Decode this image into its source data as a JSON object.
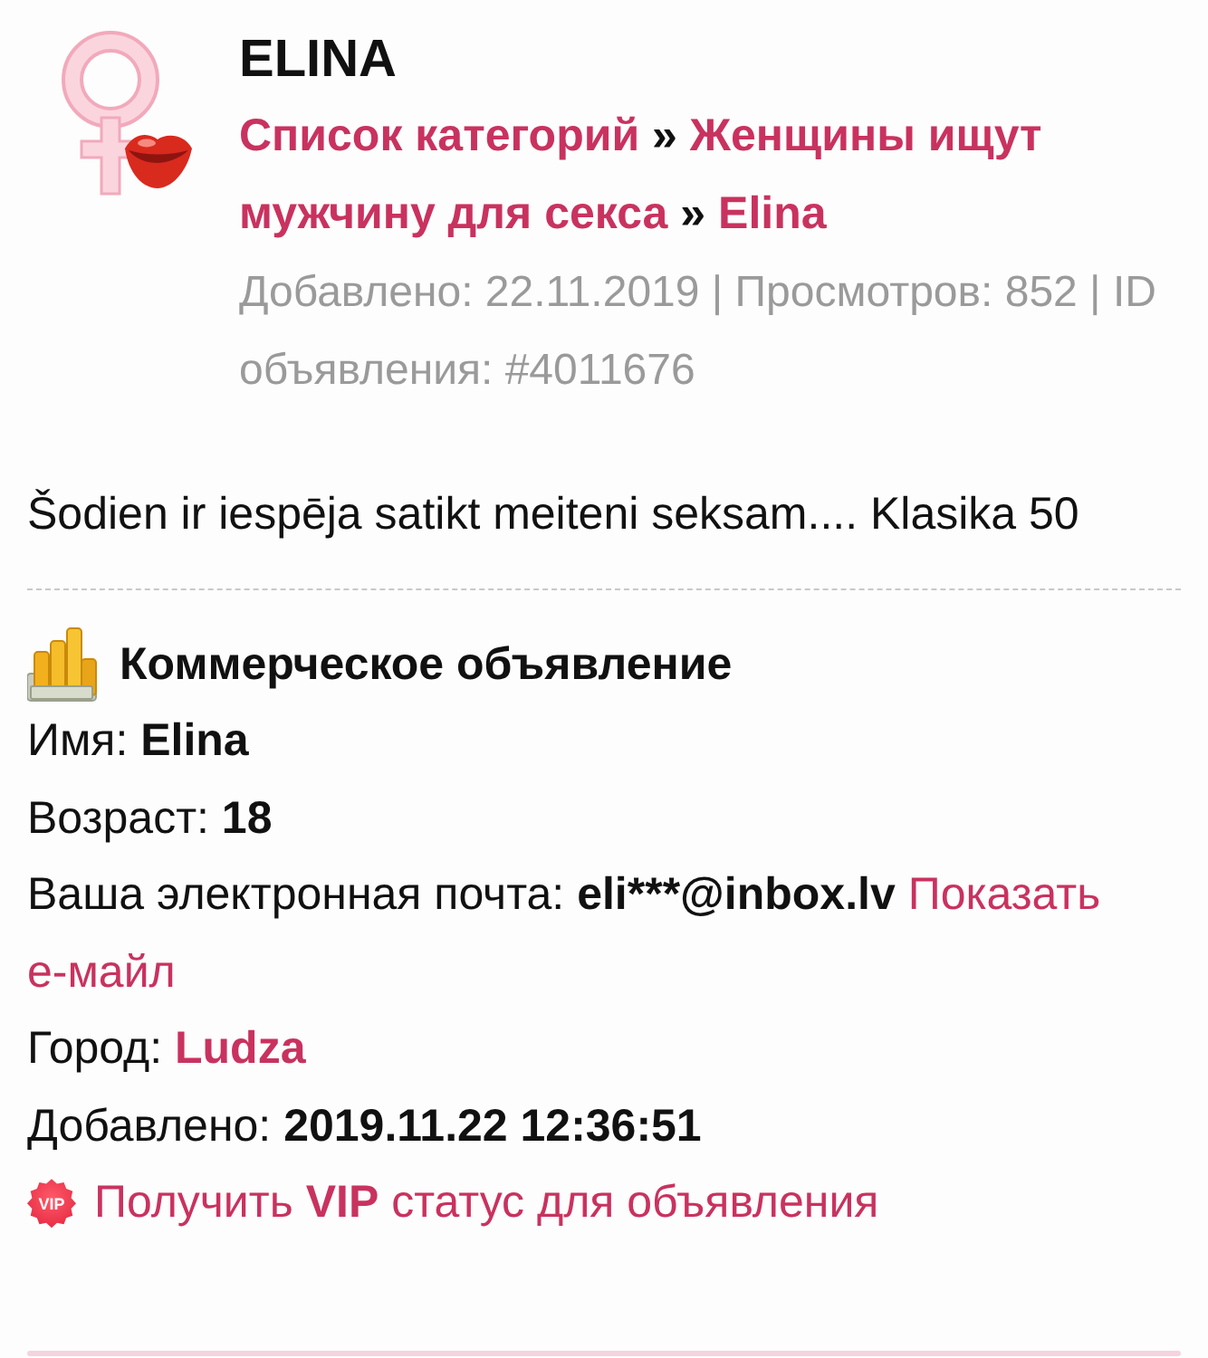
{
  "header": {
    "title": "ELINA",
    "breadcrumb": [
      {
        "kind": "link",
        "text": "Список категорий"
      },
      {
        "kind": "separator",
        "text": "»"
      },
      {
        "kind": "link",
        "text": "Женщины ищут мужчину для секса"
      },
      {
        "kind": "separator",
        "text": "»"
      },
      {
        "kind": "link",
        "text": "Elina"
      }
    ],
    "meta": "Добавлено: 22.11.2019 | Просмотров: 852 | ID объявления: #4011676"
  },
  "description": "Šodien ir iespēja satikt meiteni seksam.... Klasika 50",
  "details": {
    "title": "Коммерческое объявление",
    "fields": [
      {
        "label": "Имя:",
        "value": "Elina",
        "kind": "plain"
      },
      {
        "label": "Возраст:",
        "value": "18",
        "kind": "plain"
      },
      {
        "label": "Ваша электронная почта:",
        "value": "eli***@inbox.lv",
        "kind": "plain",
        "action": "Показать е-майл"
      },
      {
        "label": "Город:",
        "value": "Ludza",
        "kind": "link"
      },
      {
        "label": "Добавлено:",
        "value": "2019.11.22 12:36:51",
        "kind": "plain"
      }
    ]
  },
  "vip": {
    "badge": "VIP",
    "link": "Получить **VIP** статус для объявления"
  }
}
